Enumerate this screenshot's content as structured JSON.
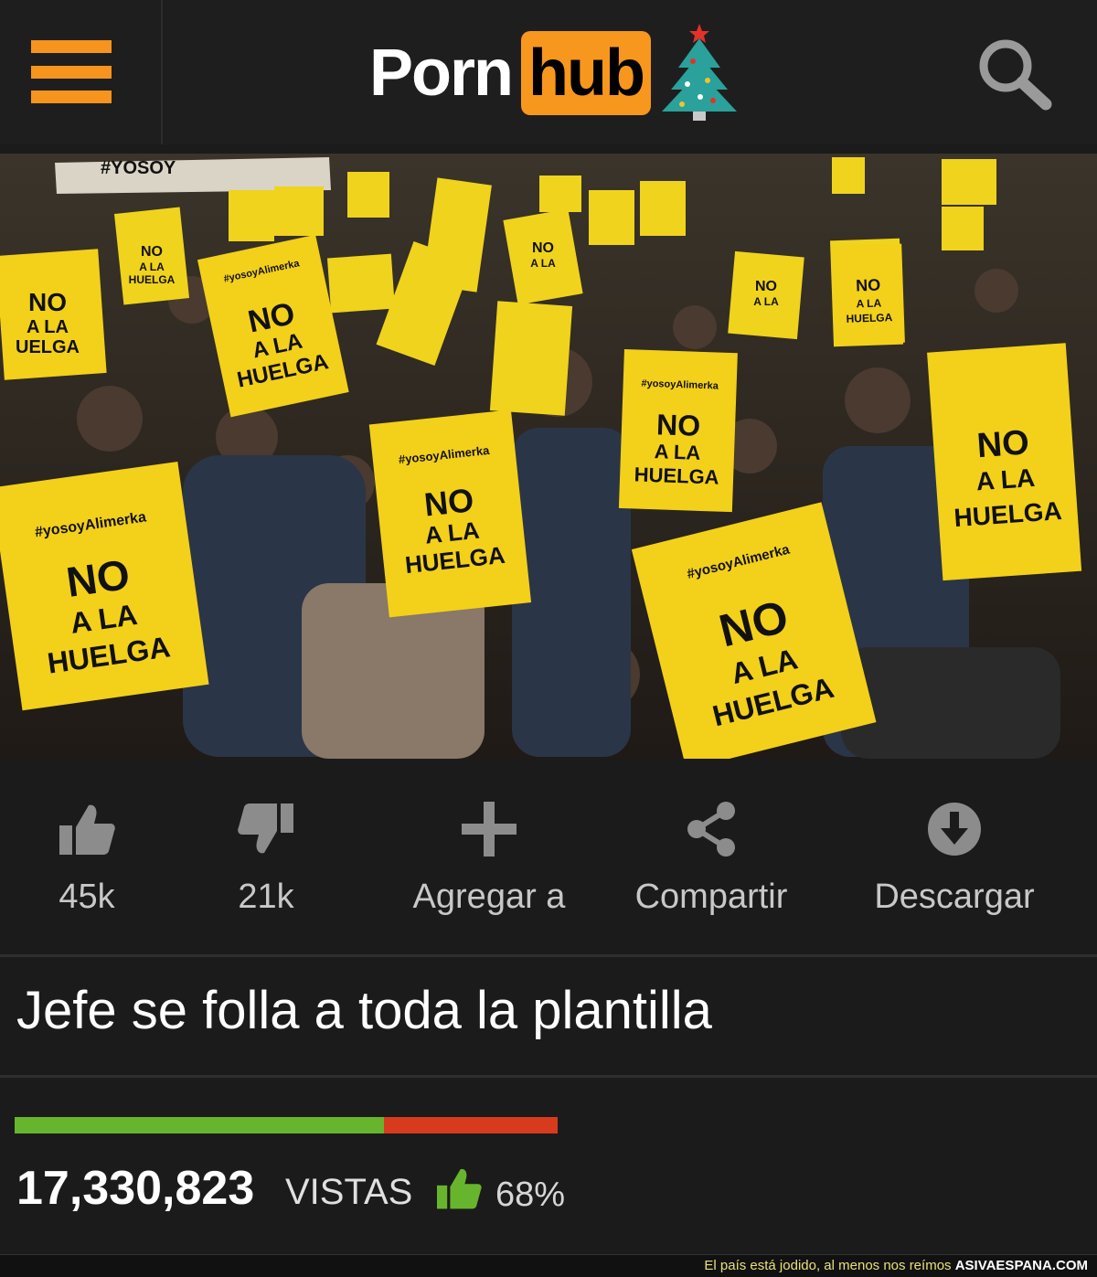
{
  "header": {
    "logo_left": "Porn",
    "logo_right": "hub",
    "accent_color": "#f7941d",
    "icons": [
      "menu-icon",
      "christmas-tree-icon",
      "search-icon"
    ]
  },
  "video": {
    "image_description_icon": "protest-crowd-photo",
    "signs": [
      {
        "hashtag": "#yosoyAlimerka",
        "line1": "NO",
        "line2": "A LA",
        "line3": "HUELGA"
      }
    ],
    "banner_text": "#YOSOY"
  },
  "actions": {
    "like_count": "45k",
    "dislike_count": "21k",
    "add_label": "Agregar a",
    "share_label": "Compartir",
    "download_label": "Descargar"
  },
  "title": "Jefe se folla a toda la plantilla",
  "stats": {
    "rating_fraction": 0.68,
    "good_color": "#67b52c",
    "bad_color": "#d83a1e",
    "views": "17,330,823",
    "views_label": "VISTAS",
    "percent": "68%"
  },
  "footer": {
    "caption": "El país está jodido, al menos nos reímos",
    "brand": "ASIVAESPANA.COM"
  }
}
